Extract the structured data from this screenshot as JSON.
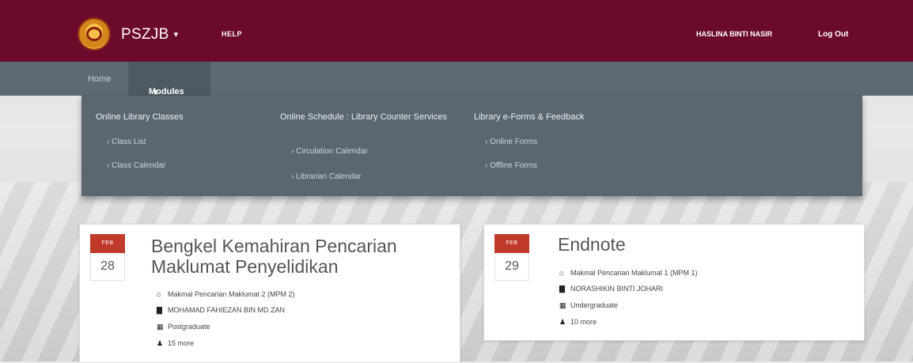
{
  "header": {
    "brand": "PSZJB",
    "brand_caret": "▾",
    "help": "HELP",
    "user_name": "HASLINA BINTI NASIR",
    "logout": "Log Out"
  },
  "nav": {
    "home": "Home",
    "modules": "Modules",
    "modules_caret": "▾"
  },
  "mega_menu": [
    {
      "heading": "Online Library Classes",
      "items": [
        "Class List",
        "Class Calendar"
      ]
    },
    {
      "heading": "Online Schedule : Library Counter Services",
      "items": [
        "Circulation Calendar",
        "Librarian Calendar"
      ]
    },
    {
      "heading": "Library e-Forms & Feedback",
      "items": [
        "Online Forms",
        "Offline Forms"
      ]
    }
  ],
  "events": [
    {
      "month": "FEB",
      "day": "28",
      "title": "Bengkel Kemahiran Pencarian Maklumat Penyelidikan",
      "location": "Makmal Pencarian Maklumat 2 (MPM 2)",
      "instructor": "MOHAMAD FAHIEZAN BIN MD ZAN",
      "audience": "Postgraduate",
      "seats": "15 more"
    },
    {
      "month": "FEB",
      "day": "29",
      "title": "Endnote",
      "location": "Makmal Pencarian Maklumat 1 (MPM 1)",
      "instructor": "NORASHIKIN BINTI JOHARI",
      "audience": "Undergraduate",
      "seats": "10 more"
    }
  ],
  "icons": {
    "location": "home-icon",
    "instructor": "book-icon",
    "audience": "grid-icon",
    "seats": "user-icon"
  },
  "colors": {
    "topbar": "#6b0a2a",
    "navbar": "#5d6a75",
    "mega_menu": "#5a6670",
    "date_badge": "#c0392b"
  }
}
